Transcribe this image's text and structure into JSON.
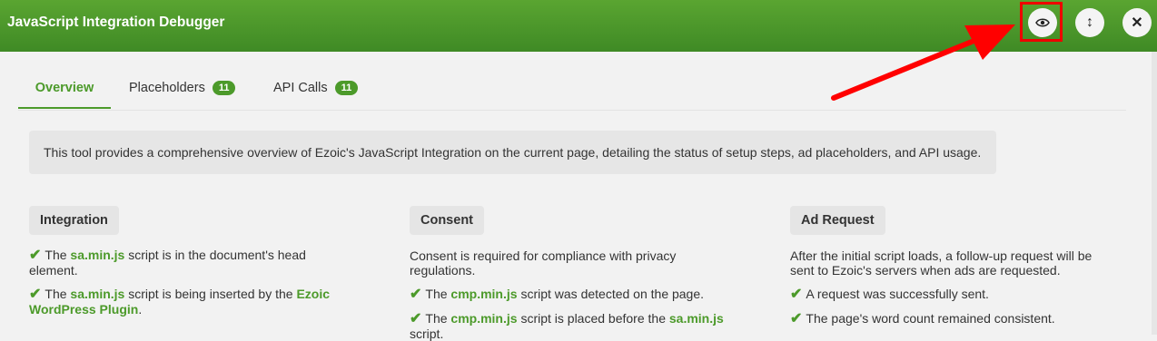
{
  "header": {
    "title": "JavaScript Integration Debugger"
  },
  "header_buttons": {
    "view_icon": "eye-icon",
    "resize_icon": "resize-vertical-icon",
    "close_icon": "close-icon",
    "close_glyph": "✕",
    "resize_glyph": "↕"
  },
  "tabs": [
    {
      "label": "Overview"
    },
    {
      "label": "Placeholders",
      "count": "11"
    },
    {
      "label": "API Calls",
      "count": "11"
    }
  ],
  "description": "This tool provides a comprehensive overview of Ezoic's JavaScript Integration on the current page, detailing the status of setup steps, ad placeholders, and API usage.",
  "integration": {
    "title": "Integration",
    "item1": {
      "pre": "The ",
      "code": "sa.min.js",
      "post": " script is in the document's head element."
    },
    "item2": {
      "pre": "The ",
      "code": "sa.min.js",
      "mid": " script is being inserted by the ",
      "link": "Ezoic WordPress Plugin",
      "post": "."
    }
  },
  "consent": {
    "title": "Consent",
    "intro": "Consent is required for compliance with privacy regulations.",
    "item1": {
      "pre": "The ",
      "code": "cmp.min.js",
      "post": " script was detected on the page."
    },
    "item2": {
      "pre": "The ",
      "code": "cmp.min.js",
      "mid": " script is placed before the ",
      "code2": "sa.min.js",
      "post": " script."
    }
  },
  "ad_request": {
    "title": "Ad Request",
    "intro": "After the initial script loads, a follow-up request will be sent to Ezoic's servers when ads are requested.",
    "item1": "A request was successfully sent.",
    "item2": "The page's word count remained consistent."
  },
  "check_glyph": "✔",
  "colors": {
    "brand_green": "#4c9a2a",
    "header_green": "#5aa531",
    "annotation_red": "#ff0000"
  }
}
